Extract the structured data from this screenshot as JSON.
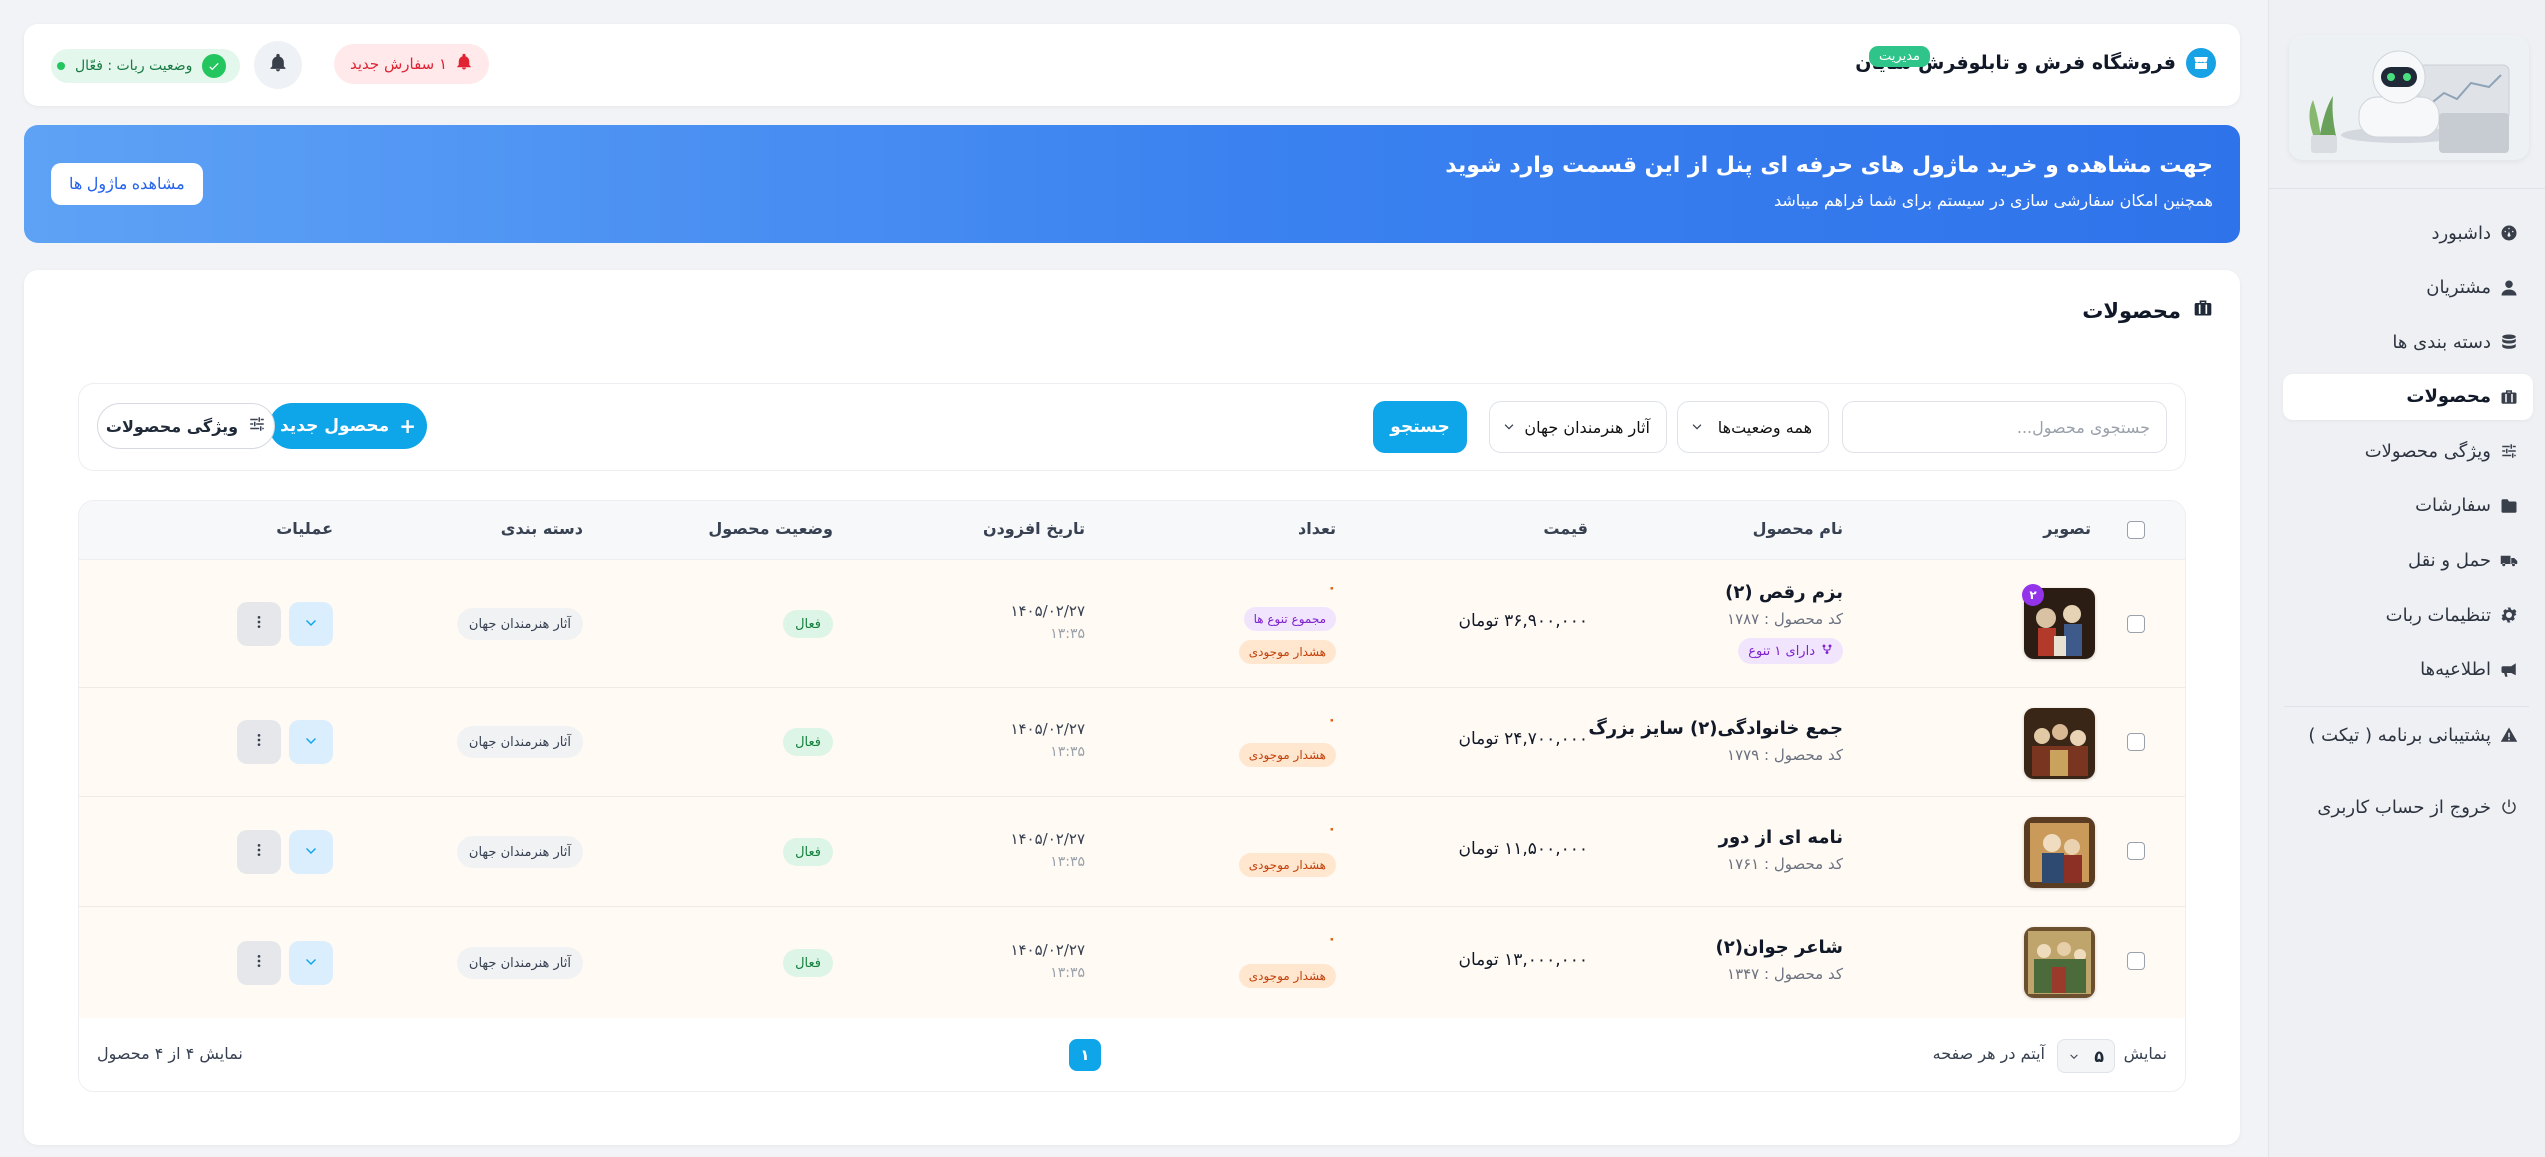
{
  "colors": {
    "accent": "#0ea5e9",
    "banner": "#3b82f0",
    "success": "#22c55e",
    "danger": "#e02433",
    "warning": "#ea580c",
    "variant": "#9333ea"
  },
  "sidebar": {
    "items": [
      {
        "label": "داشبورد",
        "icon": "dashboard-icon"
      },
      {
        "label": "مشتریان",
        "icon": "user-icon"
      },
      {
        "label": "دسته بندی ها",
        "icon": "database-icon"
      },
      {
        "label": "محصولات",
        "icon": "briefcase-icon",
        "active": true
      },
      {
        "label": "ویژگی محصولات",
        "icon": "sliders-icon"
      },
      {
        "label": "سفارشات",
        "icon": "folder-icon"
      },
      {
        "label": "حمل و نقل",
        "icon": "truck-icon"
      },
      {
        "label": "تنظیمات ربات",
        "icon": "gear-icon"
      },
      {
        "label": "اطلاعیه‌ها",
        "icon": "megaphone-icon"
      }
    ],
    "support": "پشتیبانی برنامه ( تیکت )",
    "logout": "خروج از حساب کاربری"
  },
  "header": {
    "shop_name": "فروشگاه فرش و تابلوفرش شایان",
    "role_badge": "مدیریت",
    "new_orders": "۱ سفارش جدید",
    "bot_status": "وضعیت ربات : فعّال"
  },
  "banner": {
    "title": "جهت مشاهده و خرید ماژول های حرفه ای پنل از این قسمت وارد شوید",
    "subtitle": "همچنین امکان سفارشی سازی در سیستم برای شما فراهم میباشد",
    "button": "مشاهده ماژول ها"
  },
  "products": {
    "title": "محصولات",
    "search_placeholder": "جستجوی محصول...",
    "status_filter": "همه وضعیت‌ها",
    "category_filter": "آثار هنرمندان جهان",
    "search_button": "جستجو",
    "new_button": "محصول جدید",
    "attributes_button": "ویژگی محصولات",
    "columns": {
      "image": "تصویر",
      "name": "نام محصول",
      "price": "قیمت",
      "qty": "تعداد",
      "date": "تاریخ افزودن",
      "status": "وضعیت محصول",
      "category": "دسته بندی",
      "actions": "عملیات"
    },
    "rows": [
      {
        "name": "بزم رقص (۲)",
        "code": "کد محصول : ۱۷۸۷",
        "variant_tag": "دارای ۱ تنوع",
        "variant_count": "۲",
        "price": "۳۶,۹۰۰,۰۰۰ تومان",
        "qty": "۰",
        "sum_tag": "مجموع تنوع ها",
        "stock_tag": "هشدار موجودی",
        "date": "۱۴۰۵/۰۲/۲۷",
        "time": "۱۳:۳۵",
        "status": "فعال",
        "category": "آثار هنرمندان جهان"
      },
      {
        "name": "جمع خانوادگی(۲) سایز بزرگ",
        "code": "کد محصول : ۱۷۷۹",
        "price": "۲۴,۷۰۰,۰۰۰ تومان",
        "qty": "۰",
        "stock_tag": "هشدار موجودی",
        "date": "۱۴۰۵/۰۲/۲۷",
        "time": "۱۳:۳۵",
        "status": "فعال",
        "category": "آثار هنرمندان جهان"
      },
      {
        "name": "نامه ای از دور",
        "code": "کد محصول : ۱۷۶۱",
        "price": "۱۱,۵۰۰,۰۰۰ تومان",
        "qty": "۰",
        "stock_tag": "هشدار موجودی",
        "date": "۱۴۰۵/۰۲/۲۷",
        "time": "۱۳:۳۵",
        "status": "فعال",
        "category": "آثار هنرمندان جهان"
      },
      {
        "name": "شاعر جوان(۲)",
        "code": "کد محصول : ۱۳۴۷",
        "price": "۱۳,۰۰۰,۰۰۰ تومان",
        "qty": "۰",
        "stock_tag": "هشدار موجودی",
        "date": "۱۴۰۵/۰۲/۲۷",
        "time": "۱۳:۳۵",
        "status": "فعال",
        "category": "آثار هنرمندان جهان"
      }
    ],
    "pagination": {
      "show_label": "نمایش",
      "per_page": "۵",
      "per_page_suffix": "آیتم در هر صفحه",
      "current_page": "۱",
      "summary": "نمایش ۴ از ۴ محصول"
    }
  }
}
